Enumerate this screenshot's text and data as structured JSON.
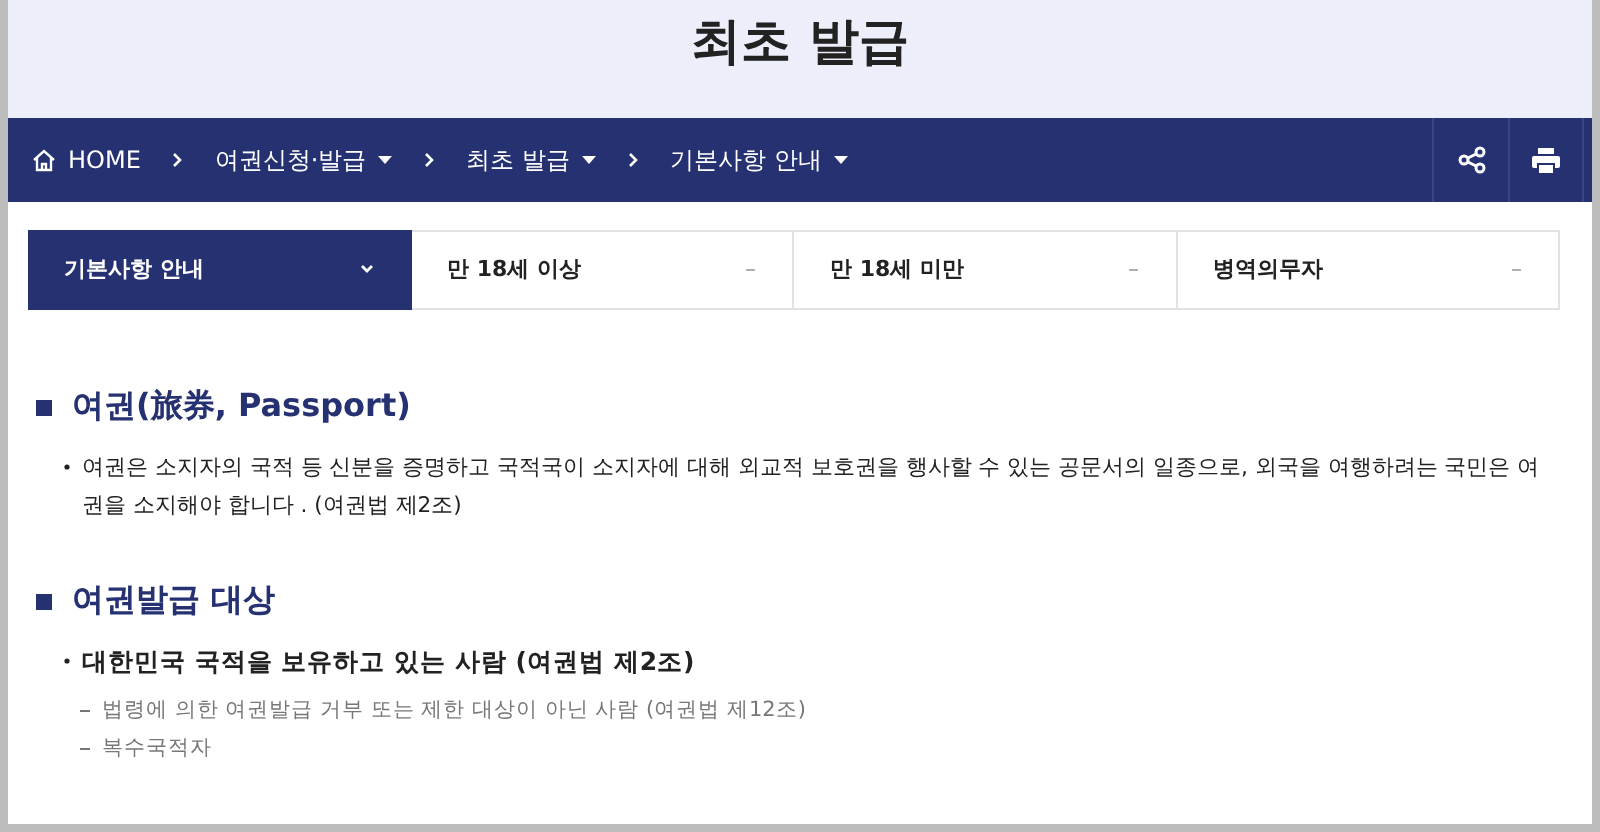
{
  "page_title": "최초 발급",
  "breadcrumb": [
    {
      "label": "HOME",
      "kind": "home"
    },
    {
      "label": "여권신청·발급",
      "kind": "menu"
    },
    {
      "label": "최초 발급",
      "kind": "menu"
    },
    {
      "label": "기본사항 안내",
      "kind": "menu"
    }
  ],
  "tabs": [
    {
      "label": "기본사항 안내",
      "selected": true
    },
    {
      "label": "만 18세 이상",
      "selected": false,
      "sign": "–"
    },
    {
      "label": "만 18세 미만",
      "selected": false,
      "sign": "–"
    },
    {
      "label": "병역의무자",
      "selected": false,
      "sign": "–"
    }
  ],
  "sections": [
    {
      "heading": "여권(旅券, Passport)",
      "items": [
        {
          "kind": "bullet",
          "text": "여권은 소지자의 국적 등 신분을 증명하고 국적국이 소지자에 대해 외교적 보호권을 행사할 수 있는 공문서의 일종으로, 외국을 여행하려는 국민은 여권을 소지해야 합니다 . (여권법 제2조)"
        }
      ]
    },
    {
      "heading": "여권발급 대상",
      "items": [
        {
          "kind": "bullet-bold",
          "text": "대한민국 국적을 보유하고 있는 사람 (여권법 제2조)"
        },
        {
          "kind": "dash",
          "text": "법령에 의한 여권발급 거부 또는 제한 대상이 아닌 사람 (여권법 제12조)"
        },
        {
          "kind": "dash",
          "text": "복수국적자"
        }
      ]
    }
  ]
}
